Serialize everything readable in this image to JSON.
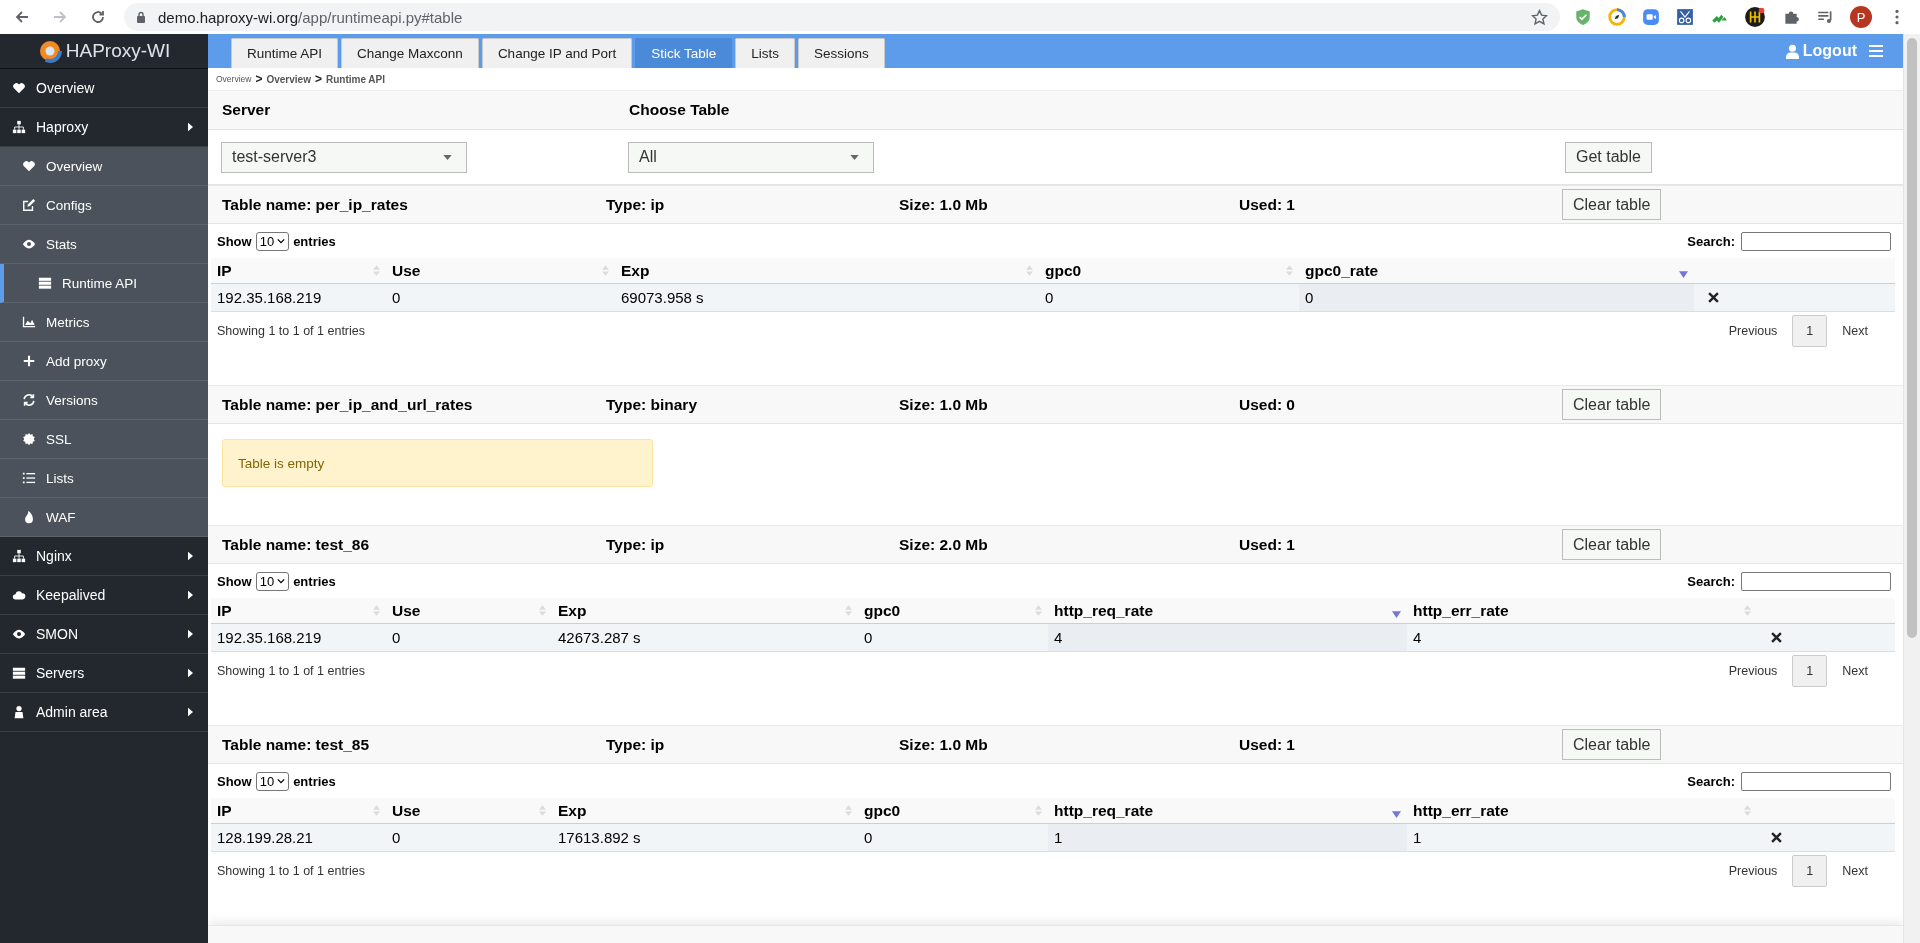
{
  "browser": {
    "url_domain": "demo.haproxy-wi.org",
    "url_path": "/app/runtimeapi.py#table",
    "profile_initial": "P"
  },
  "logo": "HAProxy-WI",
  "tabs": [
    {
      "label": "Runtime API",
      "selected": false
    },
    {
      "label": "Change Maxconn",
      "selected": false
    },
    {
      "label": "Change IP and Port",
      "selected": false
    },
    {
      "label": "Stick Table",
      "selected": true
    },
    {
      "label": "Lists",
      "selected": false
    },
    {
      "label": "Sessions",
      "selected": false
    }
  ],
  "logout": "Logout",
  "sidebar": {
    "items": [
      {
        "label": "Overview",
        "kind": "link",
        "selected": false
      },
      {
        "label": "Haproxy",
        "kind": "menu",
        "selected": false,
        "children": [
          {
            "label": "Overview",
            "selected": false
          },
          {
            "label": "Configs",
            "selected": false
          },
          {
            "label": "Stats",
            "selected": false,
            "children": [
              {
                "label": "Runtime API",
                "selected": true
              }
            ]
          },
          {
            "label": "Metrics",
            "selected": false
          },
          {
            "label": "Add proxy",
            "selected": false
          },
          {
            "label": "Versions",
            "selected": false
          },
          {
            "label": "SSL",
            "selected": false
          },
          {
            "label": "Lists",
            "selected": false
          },
          {
            "label": "WAF",
            "selected": false
          }
        ]
      },
      {
        "label": "Nginx",
        "kind": "menu",
        "selected": false
      },
      {
        "label": "Keepalived",
        "kind": "menu",
        "selected": false
      },
      {
        "label": "SMON",
        "kind": "menu",
        "selected": false
      },
      {
        "label": "Servers",
        "kind": "menu",
        "selected": false
      },
      {
        "label": "Admin area",
        "kind": "menu",
        "selected": false
      }
    ]
  },
  "breadcrumb": [
    {
      "label": "Overview"
    },
    {
      "separator": ">",
      "label": "Overview"
    },
    {
      "separator": ">",
      "label": "Runtime API"
    }
  ],
  "filters": {
    "server": {
      "label": "Server",
      "value": "test-server3"
    },
    "table": {
      "label": "Choose Table",
      "value": "All"
    },
    "button": "Get table"
  },
  "tables": [
    {
      "kind": "table",
      "name": "Table name: per_ip_rates",
      "type": "Type: ip",
      "size": "Size: 1.0 Mb",
      "used": "Used: 1",
      "clear_button": "Clear table",
      "show": "Show",
      "length": "10",
      "entries": "entries",
      "search_label": "Search:",
      "columns": [
        {
          "label": "IP",
          "sorted": false
        },
        {
          "label": "Use",
          "sorted": false
        },
        {
          "label": "Exp",
          "sorted": false
        },
        {
          "label": "gpc0",
          "sorted": false
        },
        {
          "label": "gpc0_rate",
          "sorted": true
        }
      ],
      "rows": [
        [
          "192.35.168.219",
          "0",
          "69073.958 s",
          "0",
          "0"
        ]
      ],
      "info": "Showing 1 to 1 of 1 entries",
      "pagination": {
        "previous": "Previous",
        "page": "1",
        "next": "Next"
      }
    },
    {
      "kind": "empty",
      "name": "Table name: per_ip_and_url_rates",
      "type": "Type: binary",
      "size": "Size: 1.0 Mb",
      "used": "Used: 0",
      "clear_button": "Clear table",
      "message": "Table is empty"
    },
    {
      "kind": "table",
      "name": "Table name: test_86",
      "type": "Type: ip",
      "size": "Size: 2.0 Mb",
      "used": "Used: 1",
      "clear_button": "Clear table",
      "show": "Show",
      "length": "10",
      "entries": "entries",
      "search_label": "Search:",
      "columns": [
        {
          "label": "IP",
          "sorted": false
        },
        {
          "label": "Use",
          "sorted": false
        },
        {
          "label": "Exp",
          "sorted": false
        },
        {
          "label": "gpc0",
          "sorted": false
        },
        {
          "label": "http_req_rate",
          "sorted": true
        },
        {
          "label": "http_err_rate",
          "sorted": false
        }
      ],
      "rows": [
        [
          "192.35.168.219",
          "0",
          "42673.287 s",
          "0",
          "4",
          "4"
        ]
      ],
      "info": "Showing 1 to 1 of 1 entries",
      "pagination": {
        "previous": "Previous",
        "page": "1",
        "next": "Next"
      }
    },
    {
      "kind": "table",
      "name": "Table name: test_85",
      "type": "Type: ip",
      "size": "Size: 1.0 Mb",
      "used": "Used: 1",
      "clear_button": "Clear table",
      "show": "Show",
      "length": "10",
      "entries": "entries",
      "search_label": "Search:",
      "columns": [
        {
          "label": "IP",
          "sorted": false
        },
        {
          "label": "Use",
          "sorted": false
        },
        {
          "label": "Exp",
          "sorted": false
        },
        {
          "label": "gpc0",
          "sorted": false
        },
        {
          "label": "http_req_rate",
          "sorted": true
        },
        {
          "label": "http_err_rate",
          "sorted": false
        }
      ],
      "rows": [
        [
          "128.199.28.21",
          "0",
          "17613.892 s",
          "0",
          "1",
          "1"
        ]
      ],
      "info": "Showing 1 to 1 of 1 entries",
      "pagination": {
        "previous": "Previous",
        "page": "1",
        "next": "Next"
      }
    }
  ]
}
